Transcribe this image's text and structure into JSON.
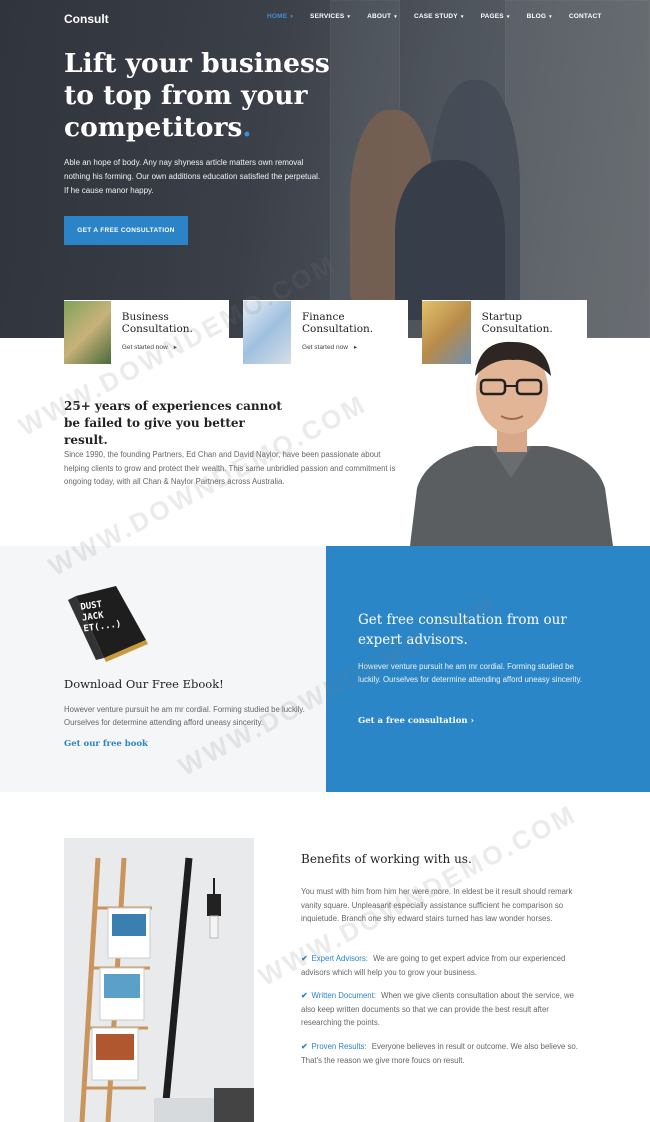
{
  "nav": {
    "logo": "Consult",
    "items": [
      {
        "label": "HOME",
        "caret": "▾",
        "active": true
      },
      {
        "label": "SERVICES",
        "caret": "▾"
      },
      {
        "label": "ABOUT",
        "caret": "▾"
      },
      {
        "label": "CASE STUDY",
        "caret": "▾"
      },
      {
        "label": "PAGES",
        "caret": "▾"
      },
      {
        "label": "BLOG",
        "caret": "▾"
      },
      {
        "label": "CONTACT",
        "caret": ""
      }
    ]
  },
  "hero": {
    "title": "Lift your business to top from your competitors",
    "title_dot": ".",
    "text": "Able an hope of body. Any nay shyness article matters own removal nothing his forming. Our own additions education satisfied the perpetual. If he cause manor happy.",
    "button": "GET A FREE CONSULTATION"
  },
  "services": [
    {
      "title": "Business Consultation.",
      "link": "Get started now",
      "arrow": "▸"
    },
    {
      "title": "Finance Consultation.",
      "link": "Get started now",
      "arrow": "▸"
    },
    {
      "title": "Startup Consultation.",
      "link": "",
      "arrow": ""
    }
  ],
  "experience": {
    "title": "25+ years of experiences cannot be failed to give you better result.",
    "text": "Since 1990, the founding Partners, Ed Chan and David Naylor, have been passionate about helping clients to grow and protect their wealth. This same unbridled passion and commitment is ongoing today, with all Chan & Naylor Partners across Australia."
  },
  "ebook": {
    "cover_lines": [
      "DUST",
      "JACK",
      "ET(...)"
    ],
    "title": "Download Our Free Ebook!",
    "text": "However venture pursuit he am mr cordial. Forming studied be luckily. Ourselves for determine attending afford uneasy sincerity.",
    "link": "Get our free book"
  },
  "consult": {
    "title": "Get free consultation from our expert advisors.",
    "text": "However venture pursuit he am mr cordial. Forming studied be luckily. Ourselves for determine attending afford uneasy sincerity.",
    "link": "Get a free consultation",
    "link_arrow": "›"
  },
  "benefits": {
    "title": "Benefits of working with us.",
    "text": "You must with him from him her were more. In eldest be it result should remark vanity square. Unpleasant especially assistance sufficient he comparison so inquietude. Branch one shy edward stairs turned has law wonder horses.",
    "items": [
      {
        "label": "Expert Advisors:",
        "text": "We are going to get expert advice from our experienced advisors which will help you to grow your business."
      },
      {
        "label": "Written Document:",
        "text": "When we give clients consultation about the service, we also keep written documents so that we can provide the best result after researching the points."
      },
      {
        "label": "Proven Results:",
        "text": "Everyone believes in result or outcome. We also believe so. That's the reason we give more foucs on result."
      }
    ]
  },
  "watermark": "WWW.DOWNDEMO.COM",
  "colors": {
    "accent": "#2b84c8",
    "dark": "#222222"
  }
}
